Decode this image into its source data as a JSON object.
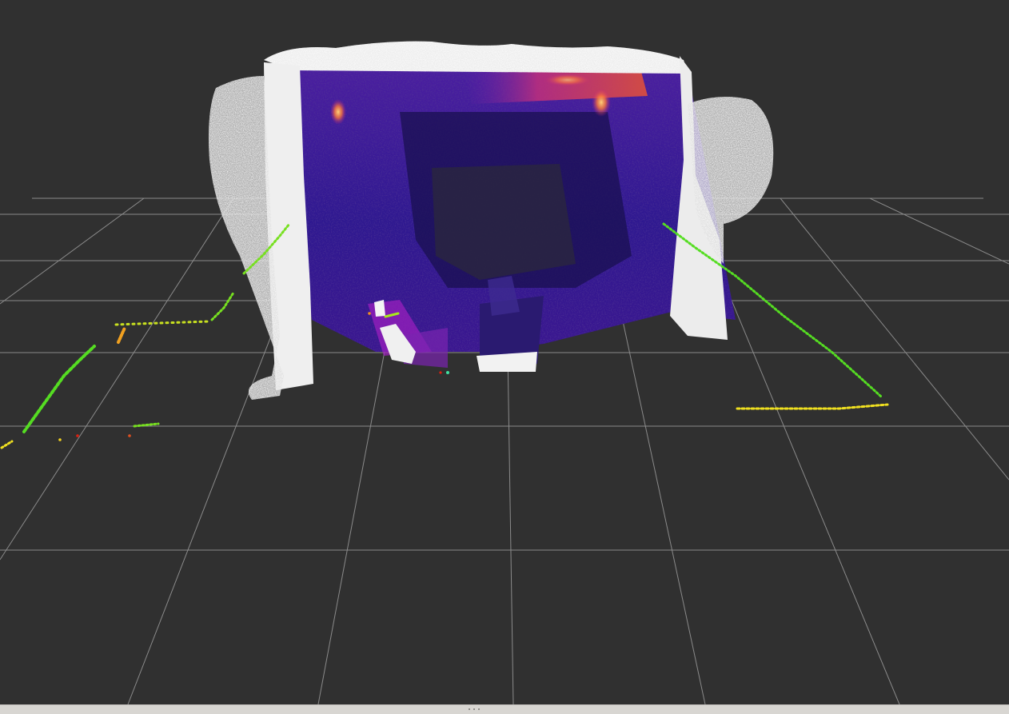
{
  "viewer": {
    "background_color": "#303030",
    "grid_color": "#a0a0a0",
    "cloud_colors": {
      "wall_white": "#f2f2f2",
      "depth_far": "#2a1a7a",
      "depth_mid": "#5a1fa8",
      "depth_near": "#9a22b5",
      "heat": "#e85a3a",
      "hot": "#ffb347"
    },
    "scan_colors": {
      "green": "#55dd22",
      "lime": "#a8e81a",
      "yellow": "#f0e020",
      "orange": "#f09020",
      "red": "#e02010"
    }
  },
  "bottom_bar": {
    "grip_icon": "grip-dots-icon",
    "color": "#d8d6d2"
  }
}
